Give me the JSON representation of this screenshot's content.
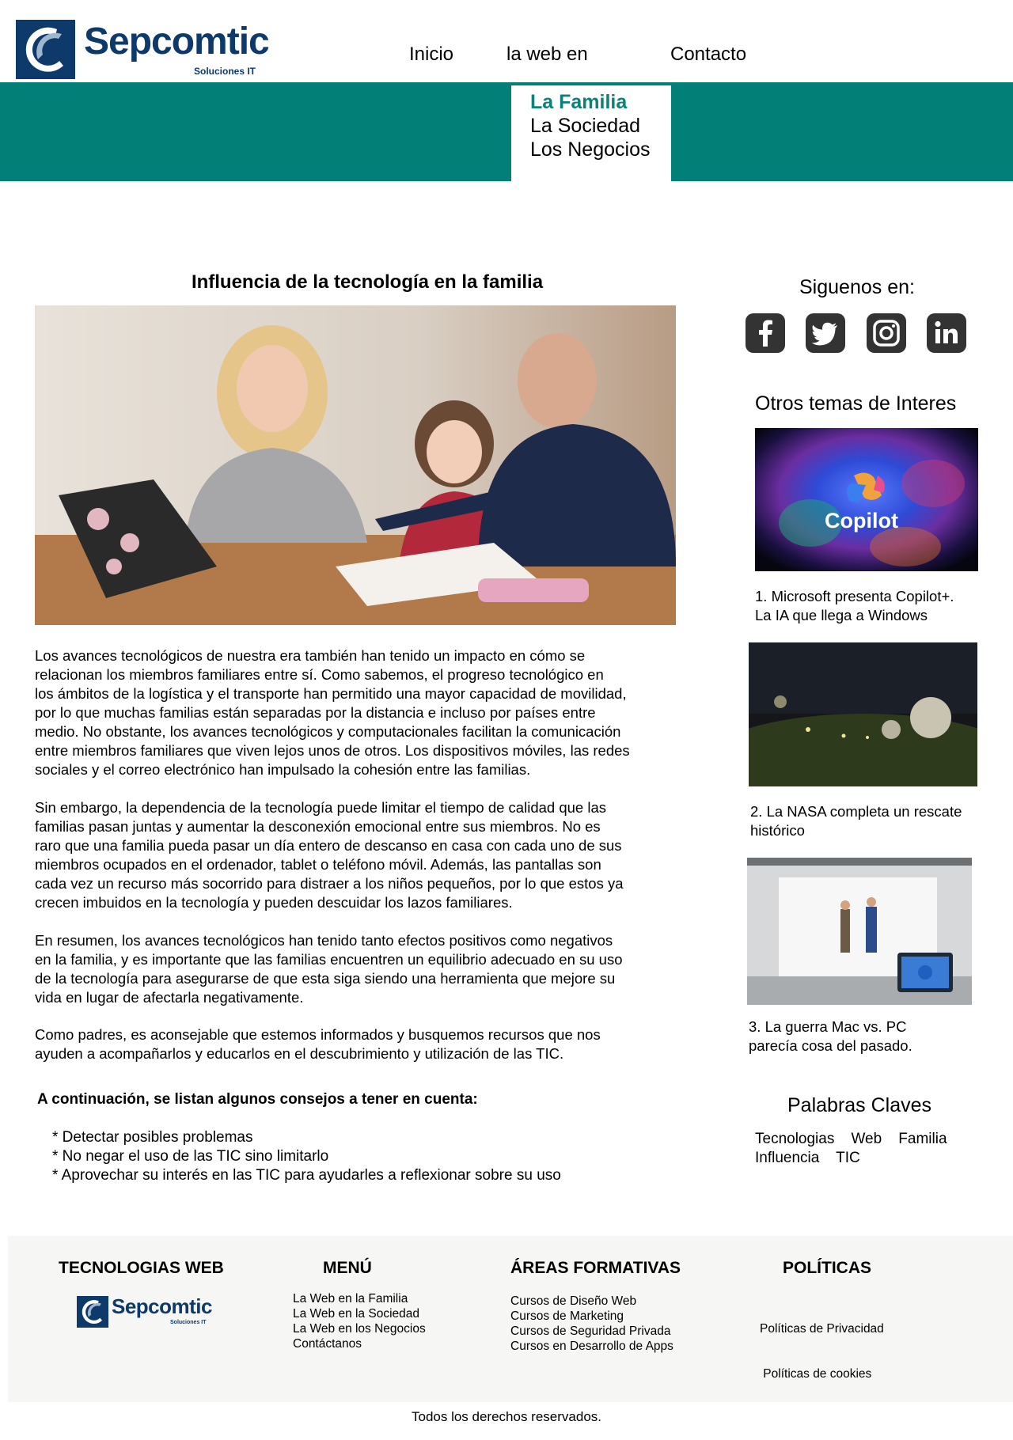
{
  "header": {
    "logo_name": "Sepcomtic",
    "logo_sub": "Soluciones IT",
    "nav": [
      "Inicio",
      "la web en",
      "Contacto"
    ],
    "dropdown": [
      "La Familia",
      "La Sociedad",
      "Los Negocios"
    ]
  },
  "article": {
    "title": "Influencia de la tecnología en la familia",
    "paragraphs": [
      "Los avances tecnológicos de nuestra era también han tenido un impacto en cómo se\nrelacionan los miembros familiares entre sí. Como sabemos, el progreso tecnológico en\nlos ámbitos de la logística y el transporte han permitido una mayor capacidad de movilidad,\n por lo que muchas familias están separadas por la distancia e incluso por países entre\nmedio. No obstante, los avances tecnológicos y computacionales facilitan la comunicación\nentre miembros familiares que viven lejos unos de otros. Los dispositivos móviles, las redes\nsociales y el correo electrónico han impulsado la cohesión entre las familias.",
      "Sin embargo, la dependencia de la tecnología puede limitar el tiempo de calidad que las\nfamilias pasan juntas y aumentar la desconexión emocional entre sus miembros. No es\nraro que una familia pueda pasar un día entero de descanso en casa con cada uno de sus\n miembros ocupados en el ordenador, tablet o teléfono móvil. Además, las pantallas son\ncada vez un recurso más socorrido para distraer a los niños pequeños, por lo que estos ya\n crecen imbuidos en la tecnología y pueden descuidar los lazos familiares.",
      "En resumen, los avances tecnológicos han tenido tanto efectos positivos como negativos\nen la familia, y es importante que las familias encuentren un equilibrio adecuado en su uso\nde la tecnología para asegurarse de que esta siga siendo una herramienta que mejore su\nvida en lugar de afectarla negativamente.",
      "Como padres, es aconsejable que estemos informados y busquemos recursos que nos\nayuden a acompañarlos y educarlos en el descubrimiento y utilización de las TIC."
    ],
    "tips_title": "A continuación, se listan algunos consejos a tener en cuenta:",
    "tips": [
      "* Detectar posibles problemas",
      "* No negar el uso de las TIC sino limitarlo",
      "* Aprovechar su interés en las TIC para ayudarles a reflexionar sobre su uso"
    ]
  },
  "sidebar": {
    "follow_title": "Siguenos en:",
    "social_icons": [
      "facebook-icon",
      "twitter-icon",
      "instagram-icon",
      "linkedin-icon"
    ],
    "other_title": "Otros temas de Interes",
    "copilot_label": "Copilot",
    "topics": [
      {
        "line1": "1. Microsoft presenta Copilot+.",
        "line2": "La IA que llega a Windows"
      },
      {
        "line1": "2. La NASA completa un rescate",
        "line2": " histórico"
      },
      {
        "line1": "3. La guerra Mac vs. PC",
        "line2": "parecía cosa del pasado."
      }
    ],
    "keywords_title": "Palabras Claves",
    "keywords_line1": "Tecnologias    Web    Familia",
    "keywords_line2": "Influencia    TIC"
  },
  "footer": {
    "col1_title": "TECNOLOGIAS WEB",
    "col2_title": "MENÚ",
    "col3_title": "ÁREAS FORMATIVAS",
    "col4_title": "POLÍTICAS",
    "menu": [
      "La Web en la Familia",
      "La Web en la Sociedad",
      "La Web en los Negocios",
      "Contáctanos"
    ],
    "areas": [
      "Cursos de Diseño Web",
      "Cursos de Marketing",
      "Cursos de Seguridad Privada",
      "Cursos en Desarrollo de Apps"
    ],
    "policies": [
      "Políticas de Privacidad",
      " Políticas de cookies"
    ],
    "copyright": "Todos los derechos reservados."
  },
  "colors": {
    "teal": "#028077",
    "brand_navy": "#0d3a6a",
    "active_link": "#0c8177"
  }
}
